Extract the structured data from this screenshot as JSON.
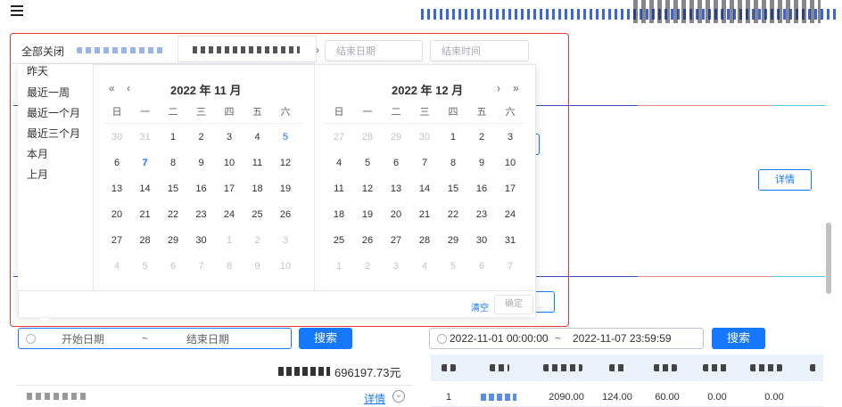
{
  "topbar": {
    "menu_icon": "hamburger-icon"
  },
  "panel": {
    "tab_close_all": "全部关闭",
    "end_date_placeholder": "结束日期",
    "end_time_placeholder": "结束时间",
    "tab_arrow": "›"
  },
  "shortcuts": [
    "昨天",
    "最近一周",
    "最近一个月",
    "最近三个月",
    "本月",
    "上月"
  ],
  "calendar_left": {
    "header": "2022 年 11 月",
    "prev_year": "«",
    "prev_month": "‹",
    "weekdays": [
      "日",
      "一",
      "二",
      "三",
      "四",
      "五",
      "六"
    ],
    "rows": [
      [
        "30",
        "31",
        "1",
        "2",
        "3",
        "4",
        "5"
      ],
      [
        "6",
        "7",
        "8",
        "9",
        "10",
        "11",
        "12"
      ],
      [
        "13",
        "14",
        "15",
        "16",
        "17",
        "18",
        "19"
      ],
      [
        "20",
        "21",
        "22",
        "23",
        "24",
        "25",
        "26"
      ],
      [
        "27",
        "28",
        "29",
        "30",
        "1",
        "2",
        "3"
      ],
      [
        "4",
        "5",
        "6",
        "7",
        "8",
        "9",
        "10"
      ]
    ]
  },
  "calendar_right": {
    "header": "2022 年 12 月",
    "next_month": "›",
    "next_year": "»",
    "weekdays": [
      "日",
      "一",
      "二",
      "三",
      "四",
      "五",
      "六"
    ],
    "rows": [
      [
        "27",
        "28",
        "29",
        "30",
        "1",
        "2",
        "3"
      ],
      [
        "4",
        "5",
        "6",
        "7",
        "8",
        "9",
        "10"
      ],
      [
        "11",
        "12",
        "13",
        "14",
        "15",
        "16",
        "17"
      ],
      [
        "18",
        "19",
        "20",
        "21",
        "22",
        "23",
        "24"
      ],
      [
        "25",
        "26",
        "27",
        "28",
        "29",
        "30",
        "31"
      ],
      [
        "1",
        "2",
        "3",
        "4",
        "5",
        "6",
        "7"
      ]
    ]
  },
  "footer": {
    "clear": "清空",
    "confirm": "确定"
  },
  "left_filter": {
    "start_placeholder": "开始日期",
    "separator": "~",
    "end_placeholder": "结束日期",
    "search": "搜索"
  },
  "left_total": {
    "value": "696197.73元"
  },
  "left_row": {
    "detail": "详情"
  },
  "right_detail": "详情",
  "right_filter": {
    "start": "2022-11-01 00:00:00",
    "separator": "~",
    "end": "2022-11-07 23:59:59",
    "search": "搜索"
  },
  "right_table": {
    "row": [
      "1",
      "2090.00",
      "124.00",
      "60.00",
      "0.00",
      "0.00"
    ]
  },
  "colors": {
    "accent": "#1677ff",
    "highlight_border": "#e53935"
  }
}
